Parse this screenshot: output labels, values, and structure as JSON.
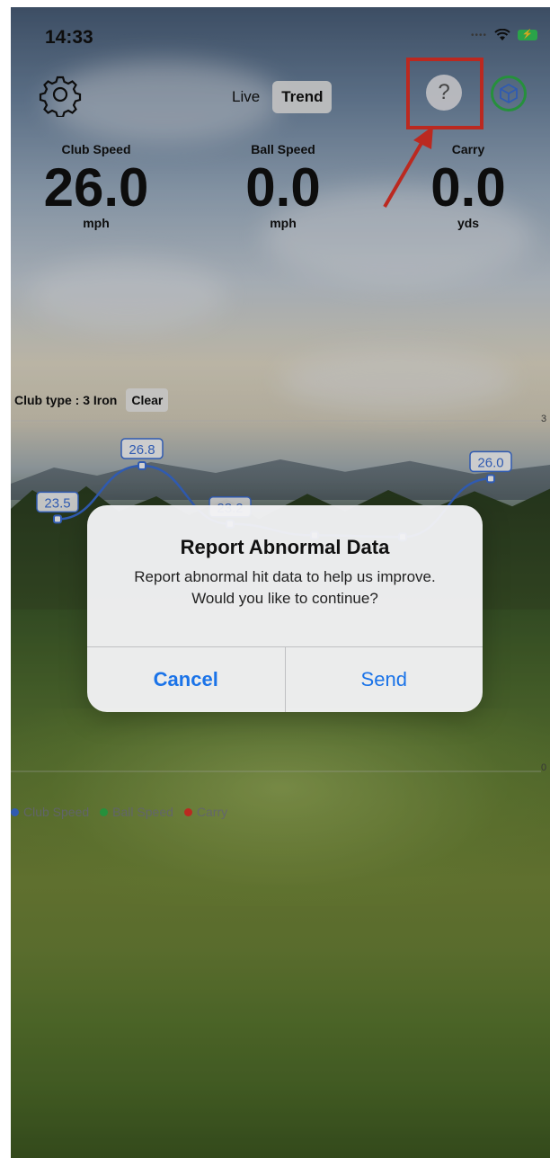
{
  "status_bar": {
    "time": "14:33",
    "battery_symbol": "⚡"
  },
  "header": {
    "settings_icon": "gear-icon",
    "tabs": [
      {
        "label": "Live",
        "selected": false
      },
      {
        "label": "Trend",
        "selected": true
      }
    ],
    "help_label": "?",
    "help_icon": "question-mark-icon",
    "model_icon": "cube-icon"
  },
  "metrics": [
    {
      "label": "Club Speed",
      "value": "26.0",
      "unit": "mph"
    },
    {
      "label": "Ball Speed",
      "value": "0.0",
      "unit": "mph"
    },
    {
      "label": "Carry",
      "value": "0.0",
      "unit": "yds"
    }
  ],
  "club": {
    "type_label": "Club type : 3 Iron",
    "clear_label": "Clear"
  },
  "chart_data": {
    "type": "line",
    "series": [
      {
        "name": "Club Speed",
        "color": "#3b6fd8",
        "values": [
          23.5,
          26.8,
          23.2,
          22.5,
          22.4,
          26.0
        ],
        "labels": [
          "23.5",
          "26.8",
          "23.2",
          "",
          "",
          "26.0"
        ]
      },
      {
        "name": "Ball Speed",
        "color": "#2fb04a",
        "values": []
      },
      {
        "name": "Carry",
        "color": "#e53228",
        "values": []
      }
    ],
    "axis_right_ticks": [
      "3",
      "0"
    ]
  },
  "dialog": {
    "title": "Report Abnormal Data",
    "message": "Report abnormal hit data to help us improve. Would you like to continue?",
    "cancel_label": "Cancel",
    "send_label": "Send"
  },
  "colors": {
    "accent": "#1a73e8",
    "highlight": "#e53228",
    "cube_ring": "#2fb04a"
  }
}
